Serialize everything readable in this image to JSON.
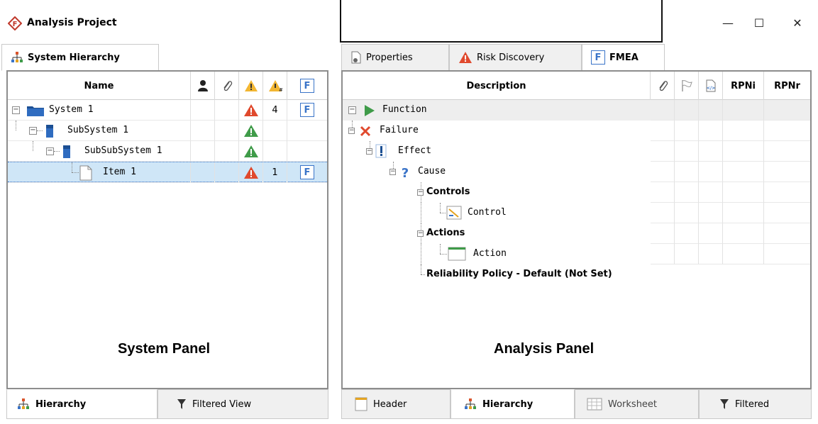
{
  "window": {
    "title": "Analysis Project",
    "minimize_glyph": "—",
    "maximize_glyph": "☐",
    "close_glyph": "✕"
  },
  "left_tabs": [
    {
      "label": "System Hierarchy",
      "icon": "hierarchy-icon",
      "active": true
    }
  ],
  "right_tabs": [
    {
      "label": "Properties",
      "icon": "properties-icon",
      "active": false
    },
    {
      "label": "Risk Discovery",
      "icon": "warning-red-icon",
      "active": false
    },
    {
      "label": "FMEA",
      "icon": "fmea-icon",
      "active": true
    }
  ],
  "system_panel": {
    "columns": {
      "name": "Name",
      "f_label": "F"
    },
    "rows": [
      {
        "name": "System 1",
        "count": "4",
        "risk": "red",
        "has_f": true,
        "selected": false
      },
      {
        "name": "SubSystem 1",
        "count": "",
        "risk": "green",
        "has_f": false,
        "selected": false
      },
      {
        "name": "SubSubSystem 1",
        "count": "",
        "risk": "green",
        "has_f": false,
        "selected": false
      },
      {
        "name": "Item 1",
        "count": "1",
        "risk": "red",
        "has_f": true,
        "selected": true
      }
    ],
    "label": "System Panel"
  },
  "analysis_panel": {
    "columns": {
      "description": "Description",
      "rpni": "RPNi",
      "rpnr": "RPNr"
    },
    "rows": {
      "function": "Function",
      "failure": "Failure",
      "effect": "Effect",
      "cause": "Cause",
      "controls": "Controls",
      "control": "Control",
      "actions": "Actions",
      "action": "Action",
      "policy": "Reliability Policy - Default (Not Set)"
    },
    "label": "Analysis Panel"
  },
  "left_bottom_tabs": [
    {
      "label": "Hierarchy",
      "icon": "hierarchy-icon",
      "active": true
    },
    {
      "label": "Filtered View",
      "icon": "filter-icon",
      "active": false
    }
  ],
  "right_bottom_tabs": [
    {
      "label": "Header",
      "icon": "header-icon",
      "active": false
    },
    {
      "label": "Hierarchy",
      "icon": "hierarchy-icon",
      "active": true
    },
    {
      "label": "Worksheet",
      "icon": "worksheet-icon",
      "active": false
    },
    {
      "label": "Filtered",
      "icon": "filter-icon",
      "active": false
    }
  ],
  "colors": {
    "accent_blue": "#3a74c8",
    "warning_red": "#e0492d",
    "warning_green": "#3f9b49",
    "warning_amber": "#f2b632",
    "selection": "#cfe6f7"
  }
}
